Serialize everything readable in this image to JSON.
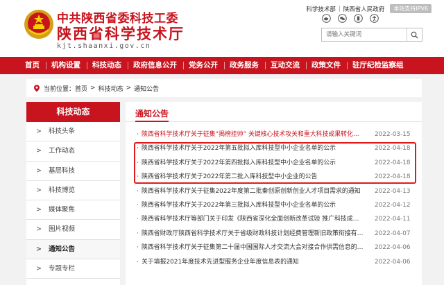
{
  "header": {
    "title_line1": "中共陕西省委科技工委",
    "title_line2": "陕西省科学技术厅",
    "domain": "kjt.shaanxi.gov.cn",
    "toplinks": [
      "科学技术部",
      "陕西省人民政府"
    ],
    "ipv6_badge": "本站支持IPV6",
    "search_placeholder": "请输入关键词",
    "icons": [
      "weibo-icon",
      "wechat-icon",
      "mobile-icon",
      "accessibility-icon"
    ]
  },
  "nav": {
    "items": [
      "首页",
      "机构设置",
      "科技动态",
      "政府信息公开",
      "党务公开",
      "政务服务",
      "互动交流",
      "政策文件",
      "驻厅纪检监察组"
    ]
  },
  "breadcrumb": {
    "label": "当前位置：",
    "items": [
      "首页",
      "科技动态",
      "通知公告"
    ],
    "separator": ">"
  },
  "sidebar": {
    "title": "科技动态",
    "items": [
      "科技头条",
      "工作动态",
      "基层科技",
      "科技博览",
      "媒体聚焦",
      "图片视频",
      "通知公告",
      "专题专栏"
    ],
    "active": "通知公告"
  },
  "main": {
    "title": "通知公告",
    "news": [
      {
        "title": "陕西省科学技术厅关于征集“揭榜挂帅” 关键核心技术攻关和重大科技成果转化项目的通知",
        "date": "2022-03-15",
        "color": "#c8141e"
      },
      {
        "title": "陕西省科学技术厅关于2022年第五批拟入库科技型中小企业名单的公示",
        "date": "2022-04-18",
        "color": "#333333"
      },
      {
        "title": "陕西省科学技术厅关于2022年第四批拟入库科技型中小企业名单的公示",
        "date": "2022-04-18",
        "color": "#333333"
      },
      {
        "title": "陕西省科学技术厅关于2022年第二批入库科技型中小企业的公告",
        "date": "2022-04-18",
        "color": "#333333"
      },
      {
        "title": "陕西省科学技术厅关于征集2022年度第二批秦创原创新创业人才项目需求的通知",
        "date": "2022-04-13",
        "color": "#333333"
      },
      {
        "title": "陕西省科学技术厅关于2022年第三批拟入库科技型中小企业名单的公示",
        "date": "2022-04-12",
        "color": "#333333"
      },
      {
        "title": "陕西省科学技术厅等部门关于印发《陕西省深化全面创新改革试验 推广科技成果转化经验的通知》",
        "date": "2022-04-11",
        "color": "#333333"
      },
      {
        "title": "陕西省财政厅陕西省科学技术厅关于省级财政科技计划经费管理新旧政策衔接有关事项的通知",
        "date": "2022-04-07",
        "color": "#333333"
      },
      {
        "title": "陕西省科学技术厅关于征集第二十届中国国际人才交流大会对接合作供需信息的通知",
        "date": "2022-04-06",
        "color": "#333333"
      },
      {
        "title": "关于填报2021年度技术先进型服务企业年度信息表的通知",
        "date": "2022-04-06",
        "color": "#333333"
      }
    ]
  },
  "colors": {
    "brand_red": "#c8141e",
    "highlight_red": "#e01919"
  }
}
